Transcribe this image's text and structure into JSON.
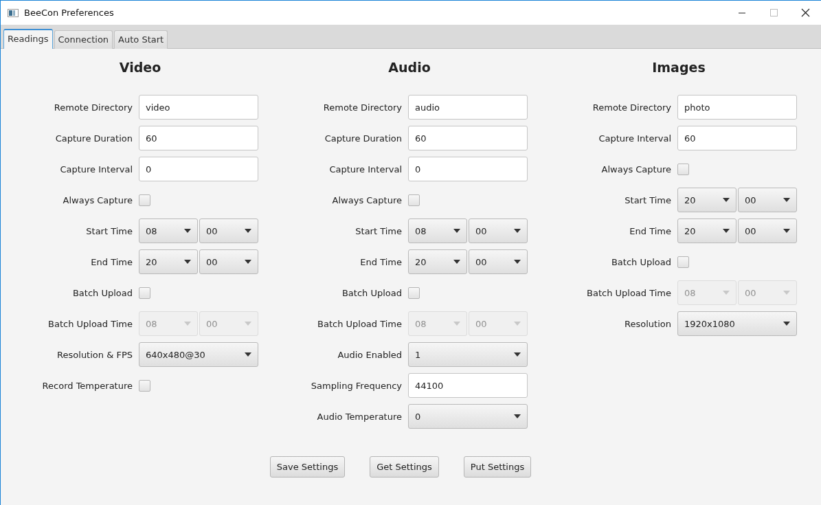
{
  "window": {
    "title": "BeeCon Preferences"
  },
  "tabs": [
    {
      "label": "Readings",
      "selected": true
    },
    {
      "label": "Connection",
      "selected": false
    },
    {
      "label": "Auto Start",
      "selected": false
    }
  ],
  "sections": [
    {
      "title": "Video",
      "rows": [
        {
          "kind": "text",
          "label": "Remote Directory",
          "value": "video"
        },
        {
          "kind": "text",
          "label": "Capture Duration",
          "value": "60"
        },
        {
          "kind": "text",
          "label": "Capture Interval",
          "value": "0"
        },
        {
          "kind": "check",
          "label": "Always Capture",
          "checked": false
        },
        {
          "kind": "time",
          "label": "Start Time",
          "hour": "08",
          "minute": "00",
          "disabled": false
        },
        {
          "kind": "time",
          "label": "End Time",
          "hour": "20",
          "minute": "00",
          "disabled": false
        },
        {
          "kind": "check",
          "label": "Batch Upload",
          "checked": false
        },
        {
          "kind": "time",
          "label": "Batch Upload Time",
          "hour": "08",
          "minute": "00",
          "disabled": true
        },
        {
          "kind": "select",
          "label": "Resolution & FPS",
          "value": "640x480@30"
        },
        {
          "kind": "check",
          "label": "Record Temperature",
          "checked": false
        }
      ]
    },
    {
      "title": "Audio",
      "rows": [
        {
          "kind": "text",
          "label": "Remote Directory",
          "value": "audio"
        },
        {
          "kind": "text",
          "label": "Capture Duration",
          "value": "60"
        },
        {
          "kind": "text",
          "label": "Capture Interval",
          "value": "0"
        },
        {
          "kind": "check",
          "label": "Always Capture",
          "checked": false
        },
        {
          "kind": "time",
          "label": "Start Time",
          "hour": "08",
          "minute": "00",
          "disabled": false
        },
        {
          "kind": "time",
          "label": "End Time",
          "hour": "20",
          "minute": "00",
          "disabled": false
        },
        {
          "kind": "check",
          "label": "Batch Upload",
          "checked": false
        },
        {
          "kind": "time",
          "label": "Batch Upload Time",
          "hour": "08",
          "minute": "00",
          "disabled": true
        },
        {
          "kind": "select",
          "label": "Audio Enabled",
          "value": "1"
        },
        {
          "kind": "text",
          "label": "Sampling Frequency",
          "value": "44100"
        },
        {
          "kind": "select",
          "label": "Audio Temperature",
          "value": "0"
        }
      ]
    },
    {
      "title": "Images",
      "rows": [
        {
          "kind": "text",
          "label": "Remote Directory",
          "value": "photo"
        },
        {
          "kind": "text",
          "label": "Capture Interval",
          "value": "60"
        },
        {
          "kind": "check",
          "label": "Always Capture",
          "checked": false
        },
        {
          "kind": "time",
          "label": "Start Time",
          "hour": "20",
          "minute": "00",
          "disabled": false
        },
        {
          "kind": "time",
          "label": "End Time",
          "hour": "20",
          "minute": "00",
          "disabled": false
        },
        {
          "kind": "check",
          "label": "Batch Upload",
          "checked": false
        },
        {
          "kind": "time",
          "label": "Batch Upload Time",
          "hour": "08",
          "minute": "00",
          "disabled": true
        },
        {
          "kind": "select",
          "label": "Resolution",
          "value": "1920x1080"
        }
      ]
    }
  ],
  "buttons": [
    "Save Settings",
    "Get Settings",
    "Put Settings"
  ]
}
